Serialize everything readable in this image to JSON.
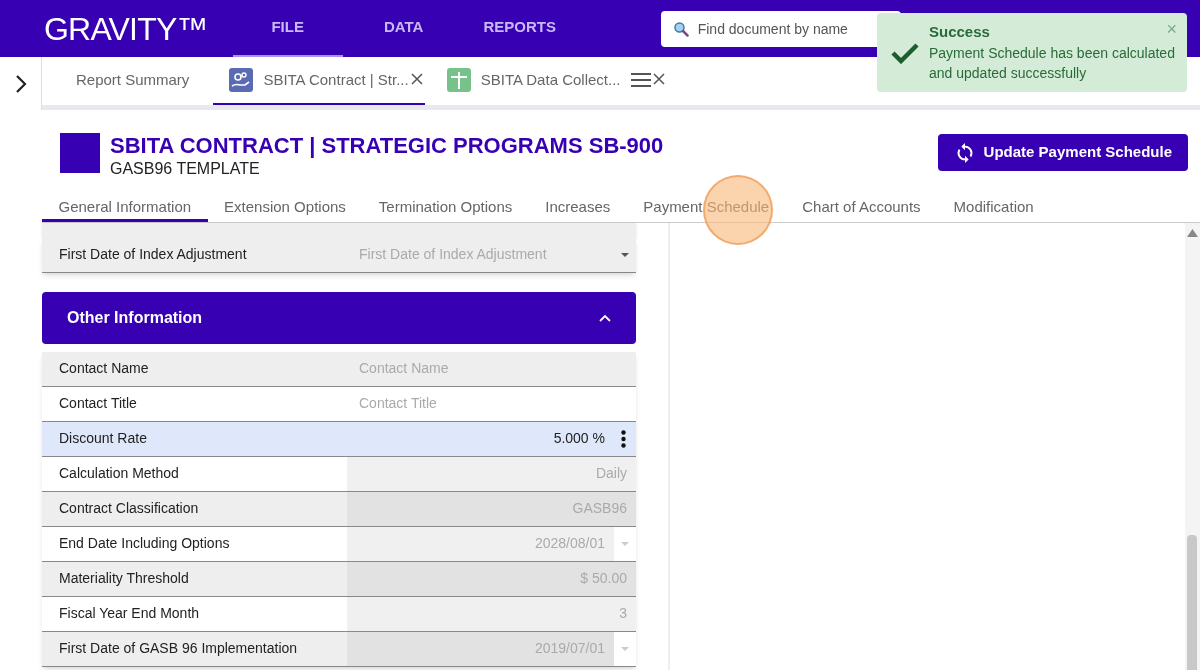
{
  "app": {
    "logo": "GRAVITY™",
    "nav": [
      {
        "label": "FILE",
        "selected": true
      },
      {
        "label": "DATA",
        "selected": false
      },
      {
        "label": "REPORTS",
        "selected": false
      }
    ],
    "search": {
      "placeholder": "Find document by name"
    }
  },
  "toast": {
    "title": "Success",
    "message": "Payment Schedule has been calculated and updated successfully",
    "close": "×"
  },
  "doc_tabs": [
    {
      "label": "Report Summary",
      "kind": "plain",
      "selected": false,
      "closable": false,
      "menu": false
    },
    {
      "label": "SBITA Contract | Str...",
      "kind": "contract",
      "selected": true,
      "closable": true,
      "menu": false
    },
    {
      "label": "SBITA Data Collect...",
      "kind": "sheet",
      "selected": false,
      "closable": true,
      "menu": true
    }
  ],
  "document": {
    "title": "SBITA CONTRACT | STRATEGIC PROGRAMS SB-900",
    "subtitle": "GASB96 TEMPLATE",
    "action": "Update Payment Schedule"
  },
  "section_tabs": [
    {
      "label": "General Information",
      "selected": true
    },
    {
      "label": "Extension Options",
      "selected": false
    },
    {
      "label": "Termination Options",
      "selected": false
    },
    {
      "label": "Increases",
      "selected": false
    },
    {
      "label": "Payment Schedule",
      "selected": false
    },
    {
      "label": "Chart of Accounts",
      "selected": false
    },
    {
      "label": "Modification",
      "selected": false
    }
  ],
  "general_fields": [
    {
      "label": "First Date of Index Adjustment",
      "placeholder": "First Date of Index Adjustment",
      "kind": "input",
      "dropdown": true,
      "menu": false,
      "selected": false
    }
  ],
  "other_information": {
    "title": "Other Information",
    "expanded": true,
    "fields": [
      {
        "label": "Contact Name",
        "placeholder": "Contact Name",
        "kind": "input",
        "dropdown": false,
        "menu": false,
        "selected": false
      },
      {
        "label": "Contact Title",
        "placeholder": "Contact Title",
        "kind": "input",
        "dropdown": false,
        "menu": false,
        "selected": false
      },
      {
        "label": "Discount Rate",
        "value": "5.000 %",
        "kind": "input",
        "dropdown": false,
        "menu": true,
        "selected": true
      },
      {
        "label": "Calculation Method",
        "value": "Daily",
        "kind": "readonly",
        "dropdown": false,
        "menu": false,
        "selected": false
      },
      {
        "label": "Contract Classification",
        "value": "GASB96",
        "kind": "readonly",
        "dropdown": false,
        "menu": false,
        "selected": false
      },
      {
        "label": "End Date Including Options",
        "value": "2028/08/01",
        "kind": "readonly",
        "dropdown": true,
        "menu": false,
        "selected": false
      },
      {
        "label": "Materiality Threshold",
        "value": "$ 50.00",
        "kind": "readonly",
        "dropdown": false,
        "menu": false,
        "selected": false
      },
      {
        "label": "Fiscal Year End Month",
        "value": "3",
        "kind": "readonly",
        "dropdown": false,
        "menu": false,
        "selected": false
      },
      {
        "label": "First Date of GASB 96 Implementation",
        "value": "2019/07/01",
        "kind": "readonly",
        "dropdown": true,
        "menu": false,
        "selected": false
      }
    ]
  }
}
